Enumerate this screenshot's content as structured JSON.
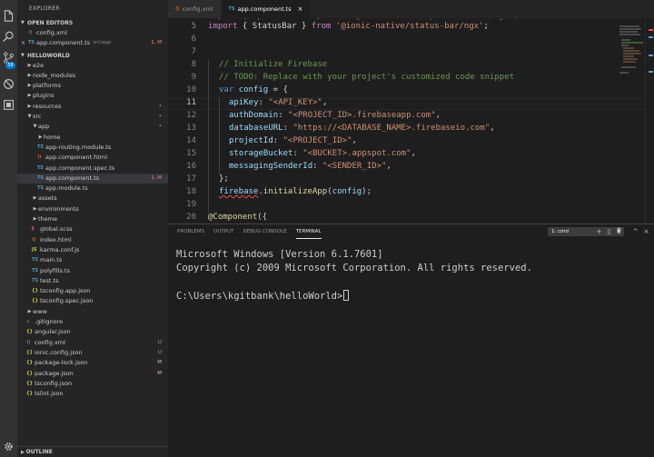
{
  "sidebar": {
    "title": "EXPLORER",
    "open_editors_title": "OPEN EDITORS",
    "open_editors": [
      {
        "icon": "xml",
        "name": "config.xml",
        "path": "",
        "status": ""
      },
      {
        "icon": "ts",
        "name": "app.component.ts",
        "path": "src\\app",
        "status": "1, M"
      }
    ],
    "project_title": "HELLOWORLD",
    "tree": [
      {
        "name": "e2e",
        "type": "folder",
        "status": ""
      },
      {
        "name": "node_modules",
        "type": "folder",
        "status": ""
      },
      {
        "name": "platforms",
        "type": "folder",
        "status": ""
      },
      {
        "name": "plugins",
        "type": "folder",
        "status": ""
      },
      {
        "name": "resources",
        "type": "folder",
        "status": "•"
      },
      {
        "name": "src",
        "type": "folder",
        "status": "•"
      },
      {
        "name": "app",
        "type": "folder",
        "status": "•"
      },
      {
        "name": "home",
        "type": "folder",
        "status": ""
      },
      {
        "name": "app-routing.module.ts",
        "type": "ts",
        "status": ""
      },
      {
        "name": "app.component.html",
        "type": "html",
        "status": ""
      },
      {
        "name": "app.component.spec.ts",
        "type": "ts",
        "status": ""
      },
      {
        "name": "app.component.ts",
        "type": "ts",
        "status": "1, M"
      },
      {
        "name": "app.module.ts",
        "type": "ts",
        "status": ""
      },
      {
        "name": "assets",
        "type": "folder",
        "status": ""
      },
      {
        "name": "environments",
        "type": "folder",
        "status": ""
      },
      {
        "name": "theme",
        "type": "folder",
        "status": ""
      },
      {
        "name": "global.scss",
        "type": "scss",
        "status": ""
      },
      {
        "name": "index.html",
        "type": "html",
        "status": ""
      },
      {
        "name": "karma.conf.js",
        "type": "js",
        "status": ""
      },
      {
        "name": "main.ts",
        "type": "ts",
        "status": ""
      },
      {
        "name": "polyfills.ts",
        "type": "ts",
        "status": ""
      },
      {
        "name": "test.ts",
        "type": "ts",
        "status": ""
      },
      {
        "name": "tsconfig.app.json",
        "type": "json",
        "status": ""
      },
      {
        "name": "tsconfig.spec.json",
        "type": "json",
        "status": ""
      },
      {
        "name": "www",
        "type": "folder",
        "status": ""
      },
      {
        "name": ".gitignore",
        "type": "git",
        "status": ""
      },
      {
        "name": "angular.json",
        "type": "json",
        "status": ""
      },
      {
        "name": "config.xml",
        "type": "xml",
        "status": "U"
      },
      {
        "name": "ionic.config.json",
        "type": "json",
        "status": "U"
      },
      {
        "name": "package-lock.json",
        "type": "json",
        "status": "M"
      },
      {
        "name": "package.json",
        "type": "json",
        "status": "M"
      },
      {
        "name": "tsconfig.json",
        "type": "json",
        "status": ""
      },
      {
        "name": "tslint.json",
        "type": "json",
        "status": ""
      }
    ],
    "outline_title": "OUTLINE",
    "scm_badge": "58"
  },
  "tabs": [
    {
      "label": "config.xml",
      "active": false
    },
    {
      "label": "app.component.ts",
      "active": true
    }
  ],
  "editor": {
    "line_numbers": [
      "5",
      "6",
      "7",
      "8",
      "9",
      "10",
      "11",
      "12",
      "13",
      "14",
      "15",
      "16",
      "17",
      "18",
      "19",
      "20"
    ],
    "code": {
      "l5_kw": "import",
      "l5_a": " { StatusBar } ",
      "l5_from": "from",
      "l5_str": "'@ionic-native/status-bar/ngx'",
      "l5_end": ";",
      "l8": "// Initialize Firebase",
      "l9": "// TODO: Replace with your project's customized code snippet",
      "l10_kw": "var",
      "l10_var": "config",
      "l10_end": " = {",
      "l11_key": "apiKey",
      "l11_val": "\"<API_KEY>\"",
      "l12_key": "authDomain",
      "l12_val": "\"<PROJECT_ID>.firebaseapp.com\"",
      "l13_key": "databaseURL",
      "l13_val": "\"https://<DATABASE_NAME>.firebaseio.com\"",
      "l14_key": "projectId",
      "l14_val": "\"<PROJECT_ID>\"",
      "l15_key": "storageBucket",
      "l15_val": "\"<BUCKET>.appspot.com\"",
      "l16_key": "messagingSenderId",
      "l16_val": "\"<SENDER_ID>\"",
      "l17": "};",
      "l18_obj": "firebase",
      "l18_fn": "initializeApp",
      "l18_arg": "config",
      "l20_dec": "@Component",
      "l20_end": "({"
    }
  },
  "panel": {
    "tabs": [
      "PROBLEMS",
      "OUTPUT",
      "DEBUG CONSOLE",
      "TERMINAL"
    ],
    "active_tab": "TERMINAL",
    "terminal_select": "1: cmd",
    "actions": [
      "+",
      "▯",
      "🗑",
      "^",
      "×"
    ],
    "terminal_lines": [
      "Microsoft Windows [Version 6.1.7601]",
      "Copyright (c) 2009 Microsoft Corporation. All rights reserved.",
      "",
      "C:\\Users\\kgitbank\\helloWorld>"
    ]
  },
  "colors": {
    "accent": "#007acc",
    "modified": "#e2c08d",
    "untracked": "#73c991",
    "error": "#f48771"
  }
}
